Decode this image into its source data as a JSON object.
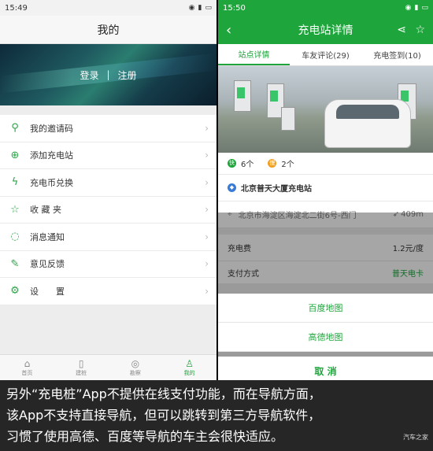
{
  "left": {
    "status_time": "15:49",
    "title": "我的",
    "login": "登录",
    "sep": "|",
    "register": "注册",
    "menu": [
      {
        "label": "我的邀请码",
        "icon": "person-add-icon"
      },
      {
        "label": "添加充电站",
        "icon": "plus-circle-icon"
      },
      {
        "label": "充电币兑换",
        "icon": "lightning-icon"
      },
      {
        "label": "收 藏 夹",
        "icon": "star-icon"
      },
      {
        "label": "消息通知",
        "icon": "chat-icon"
      },
      {
        "label": "意见反馈",
        "icon": "feedback-icon"
      },
      {
        "label": "设　　置",
        "icon": "gear-icon"
      }
    ],
    "tabbar": [
      {
        "label": "首页",
        "icon": "home-icon"
      },
      {
        "label": "建桩",
        "icon": "pile-icon"
      },
      {
        "label": "勘察",
        "icon": "compass-icon"
      },
      {
        "label": "我的",
        "icon": "person-icon"
      }
    ]
  },
  "right": {
    "status_time": "15:50",
    "title": "充电站详情",
    "tabs": [
      "站点详情",
      "车友评论(29)",
      "充电签到(10)"
    ],
    "fast_label": "快",
    "fast_count": "6个",
    "slow_label": "慢",
    "slow_count": "2个",
    "station_name": "北京普天大厦充电站",
    "address": "北京市海淀区海淀北二街6号-西门",
    "distance": "409m",
    "fee_label": "充电费",
    "fee_value": "1.2元/度",
    "pay_label": "支付方式",
    "pay_value": "普天电卡",
    "sheet_options": [
      "百度地图",
      "高德地图"
    ],
    "cancel": "取 消"
  },
  "caption": {
    "lines": [
      "另外“充电桩”App不提供在线支付功能，而在导航方面，",
      "该App不支持直接导航，但可以跳转到第三方导航软件，",
      "习惯了使用高德、百度等导航的车主会很快适应。"
    ],
    "logo": "汽车之家"
  },
  "colors": {
    "accent": "#1ea63c"
  }
}
